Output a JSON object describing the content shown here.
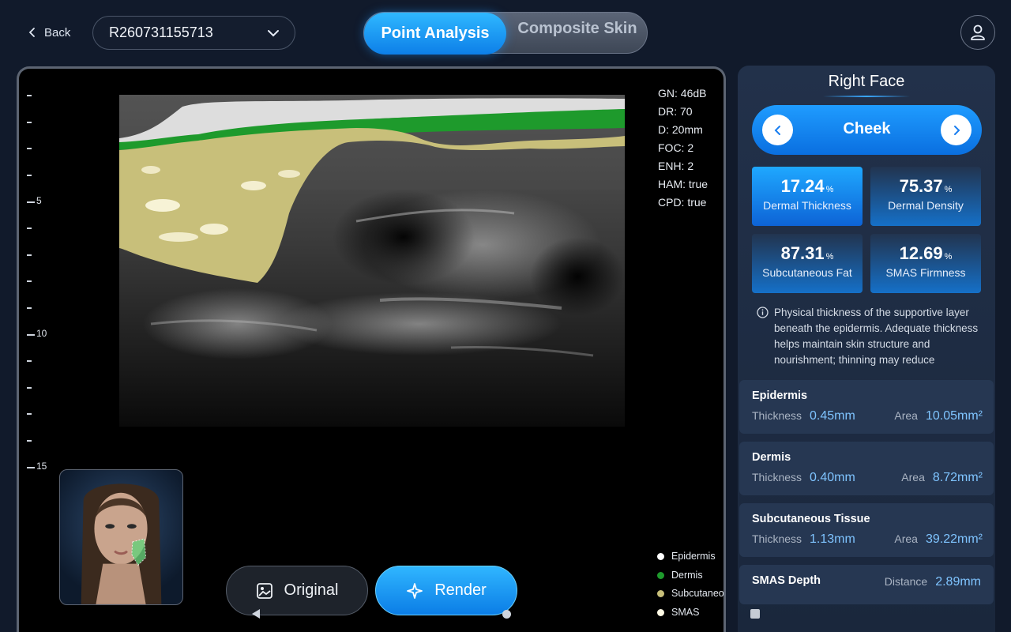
{
  "header": {
    "back_label": "Back",
    "record_id": "R260731155713",
    "modes": [
      "Point Analysis",
      "Composite Skin"
    ],
    "active_mode": "Point Analysis"
  },
  "viewport": {
    "scale_labels": [
      "5",
      "10",
      "15"
    ],
    "params": [
      "GN: 46dB",
      "DR: 70",
      "D: 20mm",
      "FOC: 2",
      "ENH: 2",
      "HAM: true",
      "CPD: true"
    ],
    "legend": [
      {
        "label": "Epidermis",
        "color": "#ffffff"
      },
      {
        "label": "Dermis",
        "color": "#1e9a2c"
      },
      {
        "label": "Subcutaneous Tissue",
        "color": "#c8bf7a"
      },
      {
        "label": "SMAS",
        "color": "#fffbe6"
      }
    ],
    "buttons": {
      "original": "Original",
      "render": "Render"
    }
  },
  "panel": {
    "title": "Right Face",
    "region": "Cheek",
    "metrics": [
      {
        "value": "17.24",
        "unit": "%",
        "label": "Dermal Thickness",
        "active": true
      },
      {
        "value": "75.37",
        "unit": "%",
        "label": "Dermal Density",
        "active": false
      },
      {
        "value": "87.31",
        "unit": "%",
        "label": "Subcutaneous Fat",
        "active": false
      },
      {
        "value": "12.69",
        "unit": "%",
        "label": "SMAS Firmness",
        "active": false
      }
    ],
    "info": "Physical thickness of the supportive layer beneath the epidermis. Adequate thickness helps maintain skin structure and nourishment; thinning may reduce",
    "layers": [
      {
        "name": "Epidermis",
        "thickness_label": "Thickness",
        "thickness": "0.45mm",
        "area_label": "Area",
        "area": "10.05mm²"
      },
      {
        "name": "Dermis",
        "thickness_label": "Thickness",
        "thickness": "0.40mm",
        "area_label": "Area",
        "area": "8.72mm²"
      },
      {
        "name": "Subcutaneous Tissue",
        "thickness_label": "Thickness",
        "thickness": "1.13mm",
        "area_label": "Area",
        "area": "39.22mm²"
      }
    ],
    "smas": {
      "name": "SMAS Depth",
      "distance_label": "Distance",
      "distance": "2.89mm"
    }
  }
}
